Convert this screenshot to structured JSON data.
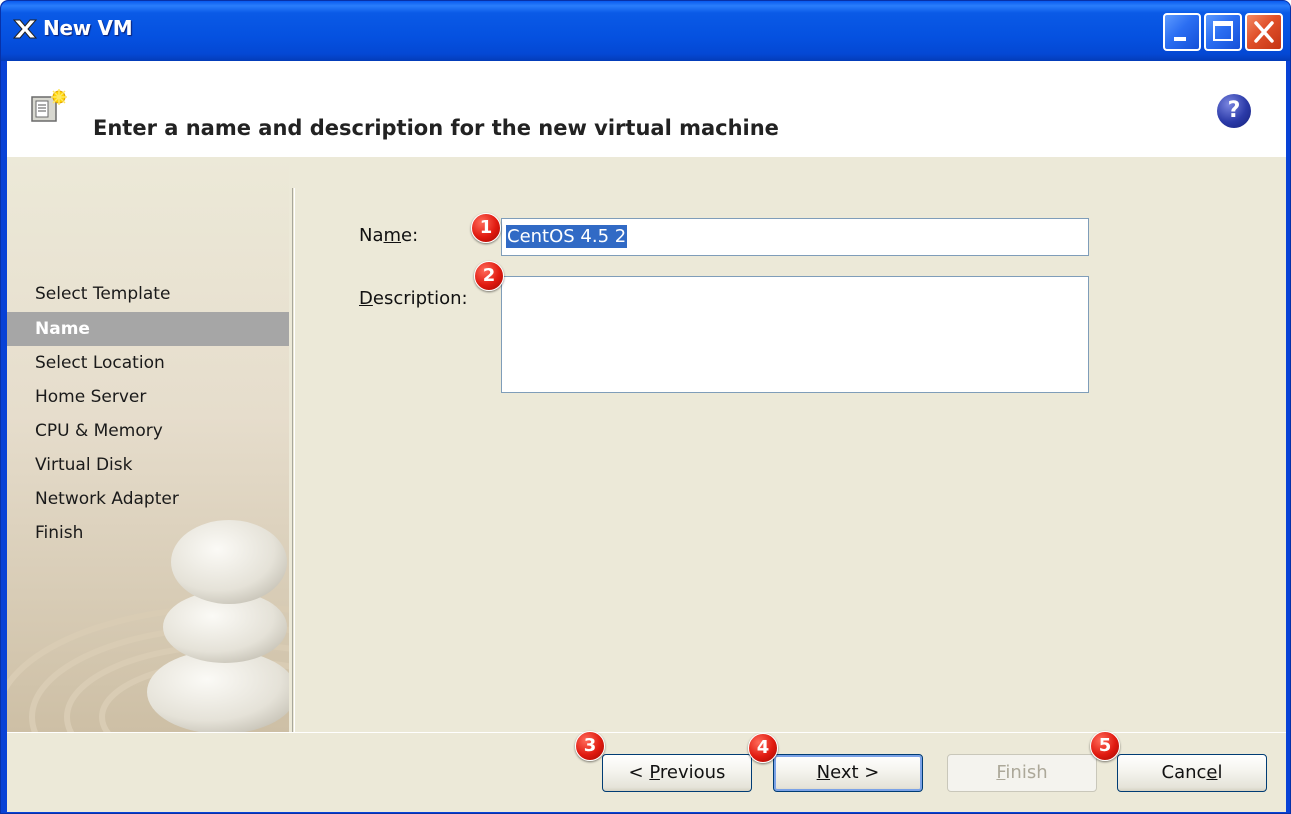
{
  "window": {
    "title": "New VM",
    "minimize_icon": "minimize-icon",
    "maximize_icon": "maximize-icon",
    "close_icon": "close-icon"
  },
  "header": {
    "title": "Enter a name and description for the new virtual machine",
    "icon": "new-vm-wizard-icon",
    "help_label": "?"
  },
  "sidebar": {
    "items": [
      {
        "label": "Select Template",
        "active": false
      },
      {
        "label": "Name",
        "active": true
      },
      {
        "label": "Select Location",
        "active": false
      },
      {
        "label": "Home Server",
        "active": false
      },
      {
        "label": "CPU & Memory",
        "active": false
      },
      {
        "label": "Virtual Disk",
        "active": false
      },
      {
        "label": "Network Adapter",
        "active": false
      },
      {
        "label": "Finish",
        "active": false
      }
    ]
  },
  "form": {
    "name_label_before": "Na",
    "name_label_mnemonic": "m",
    "name_label_after": "e:",
    "name_value": "CentOS 4.5 2",
    "description_label_mnemonic": "D",
    "description_label_after": "escription:",
    "description_value": ""
  },
  "buttons": {
    "previous_prefix": "< ",
    "previous_mnemonic": "P",
    "previous_rest": "revious",
    "next_mnemonic": "N",
    "next_rest": "ext >",
    "finish_mnemonic": "F",
    "finish_rest": "inish",
    "cancel_before": "Canc",
    "cancel_mnemonic": "e",
    "cancel_after": "l"
  },
  "badges": [
    "1",
    "2",
    "3",
    "4",
    "5"
  ],
  "colors": {
    "titlebar": "#0a5ae6",
    "client": "#ece9d8",
    "active_item": "#a6a6a6",
    "selection": "#316ac5",
    "badge": "#e01a10"
  }
}
